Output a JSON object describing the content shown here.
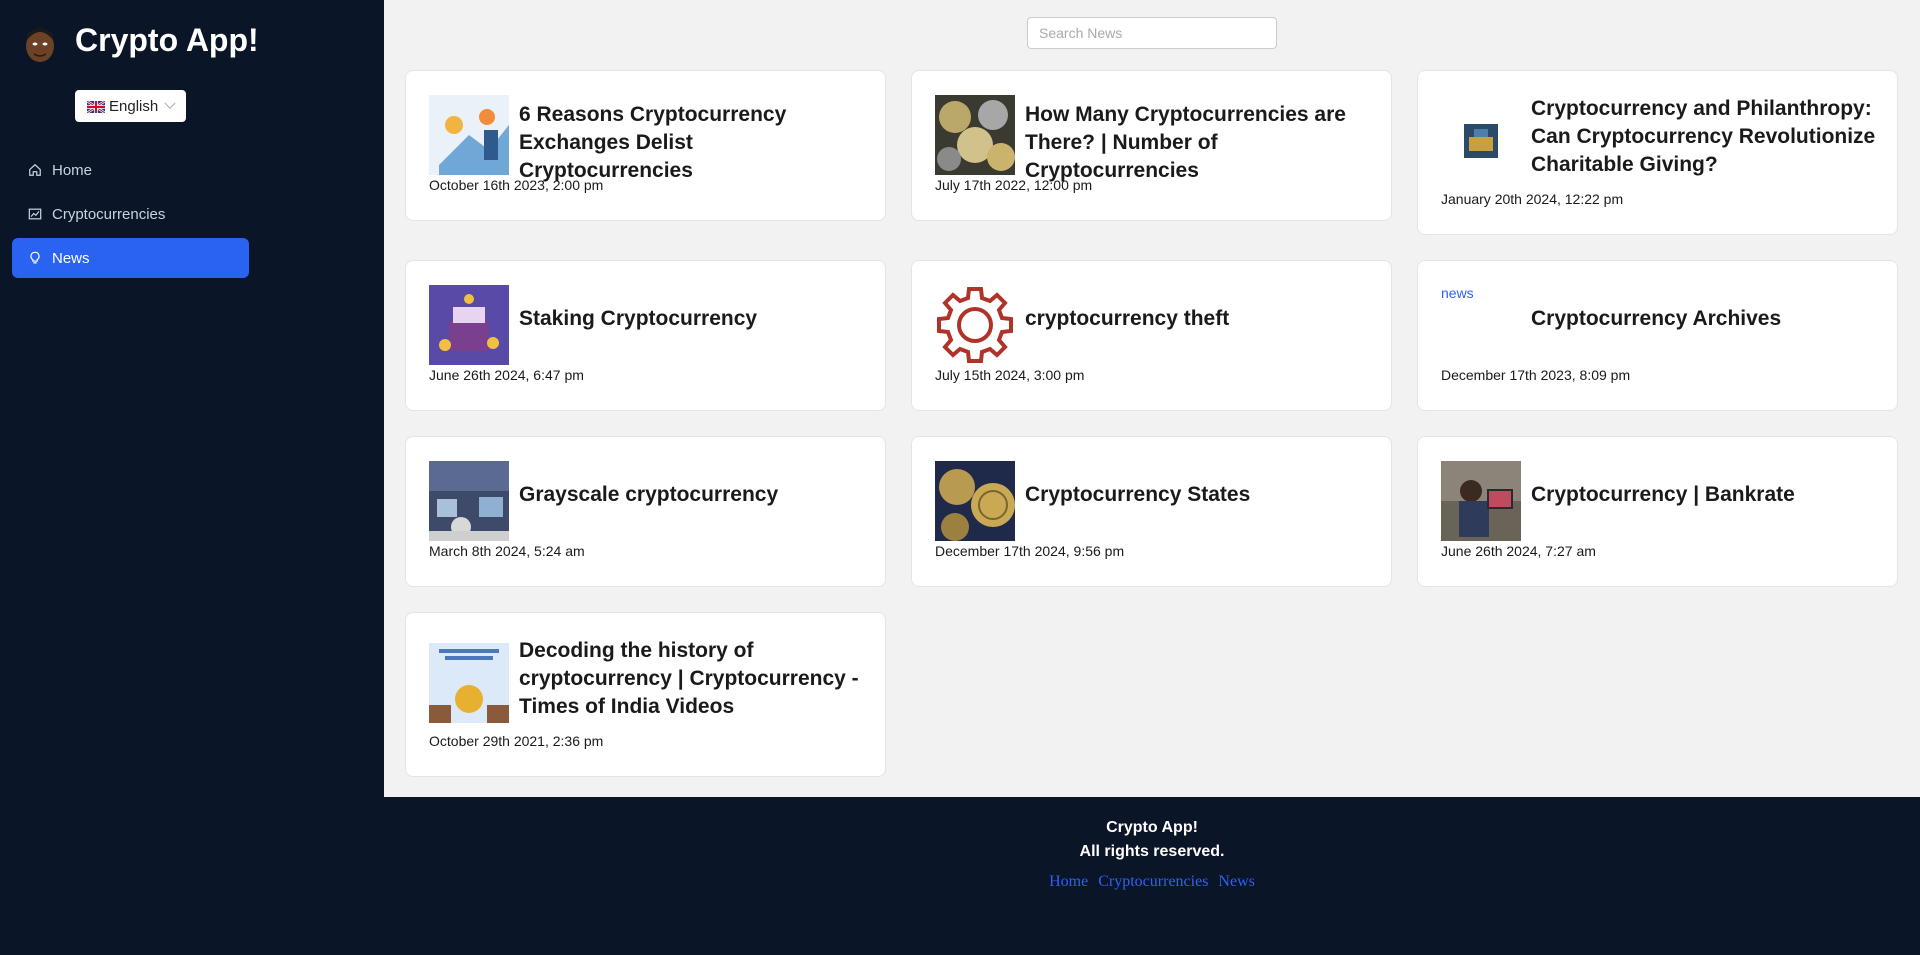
{
  "app": {
    "title": "Crypto App!"
  },
  "language": {
    "selected": "English"
  },
  "sidebar": {
    "items": [
      {
        "label": "Home",
        "icon": "home-icon"
      },
      {
        "label": "Cryptocurrencies",
        "icon": "chart-icon"
      },
      {
        "label": "News",
        "icon": "bulb-icon",
        "active": true
      }
    ]
  },
  "search": {
    "placeholder": "Search News"
  },
  "news": [
    {
      "title": "6 Reasons Cryptocurrency Exchanges Delist Cryptocurrencies",
      "date": "October 16th 2023, 2:00 pm"
    },
    {
      "title": "How Many Cryptocurrencies are There? | Number of Cryptocurrencies",
      "date": "July 17th 2022, 12:00 pm"
    },
    {
      "title": "Cryptocurrency and Philanthropy: Can Cryptocurrency Revolutionize Charitable Giving?",
      "date": "January 20th 2024, 12:22 pm"
    },
    {
      "title": "Staking Cryptocurrency",
      "date": "June 26th 2024, 6:47 pm"
    },
    {
      "title": "cryptocurrency theft",
      "date": "July 15th 2024, 3:00 pm"
    },
    {
      "title": "Cryptocurrency Archives",
      "date": "December 17th 2023, 8:09 pm",
      "broken_image_alt": "news"
    },
    {
      "title": "Grayscale cryptocurrency",
      "date": "March 8th 2024, 5:24 am"
    },
    {
      "title": "Cryptocurrency States",
      "date": "December 17th 2024, 9:56 pm"
    },
    {
      "title": "Cryptocurrency | Bankrate",
      "date": "June 26th 2024, 7:27 am"
    },
    {
      "title": "Decoding the history of cryptocurrency | Cryptocurrency - Times of India Videos",
      "date": "October 29th 2021, 2:36 pm"
    }
  ],
  "footer": {
    "title": "Crypto App!",
    "rights": "All rights reserved.",
    "links": [
      "Home",
      "Cryptocurrencies",
      "News"
    ]
  }
}
